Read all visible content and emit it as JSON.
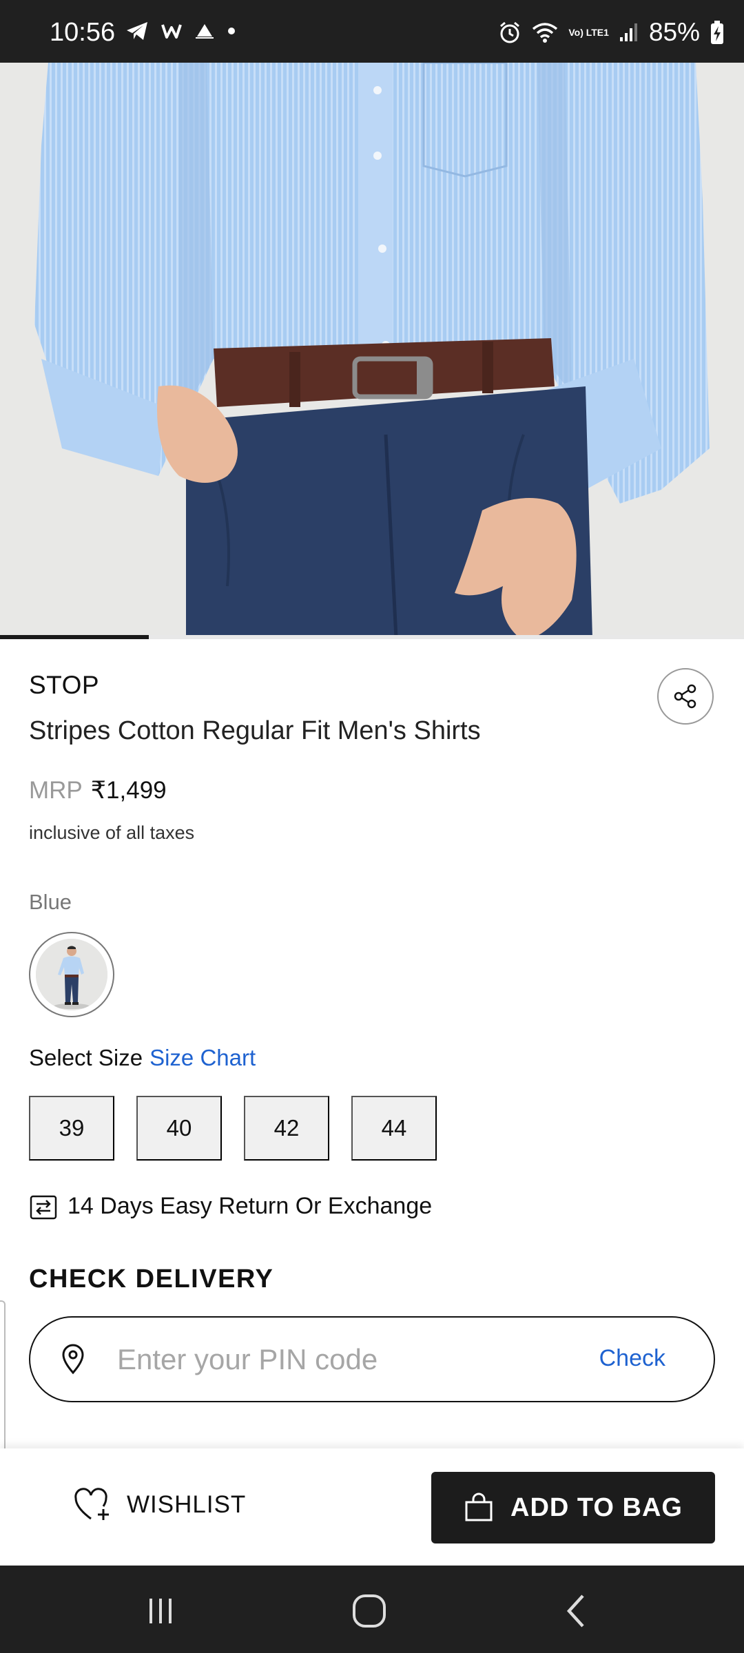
{
  "status_bar": {
    "time": "10:56",
    "battery": "85%",
    "network": "Vo) LTE1"
  },
  "gallery": {
    "current_image": 1,
    "total_images": 5,
    "image_subject": "man in light blue striped shirt, brown belt, navy trousers"
  },
  "product": {
    "brand": "STOP",
    "title": "Stripes Cotton Regular Fit Men's Shirts",
    "mrp_label": "MRP",
    "price": "₹1,499",
    "tax_note": "inclusive of all taxes"
  },
  "color": {
    "label": "Blue",
    "swatch_icon": "product-thumbnail"
  },
  "size": {
    "label": "Select Size",
    "chart_link": "Size Chart",
    "options": [
      "39",
      "40",
      "42",
      "44"
    ]
  },
  "returns": {
    "text": "14 Days Easy Return Or Exchange",
    "icon": "exchange-icon"
  },
  "delivery": {
    "heading": "CHECK DELIVERY",
    "placeholder": "Enter your PIN code",
    "value": "",
    "check_label": "Check"
  },
  "actions": {
    "wishlist_label": "WISHLIST",
    "add_to_bag_label": "ADD TO BAG"
  },
  "colors": {
    "accent_link": "#1e62d0",
    "primary_button": "#1c1c1c",
    "system_bar": "#202020"
  }
}
